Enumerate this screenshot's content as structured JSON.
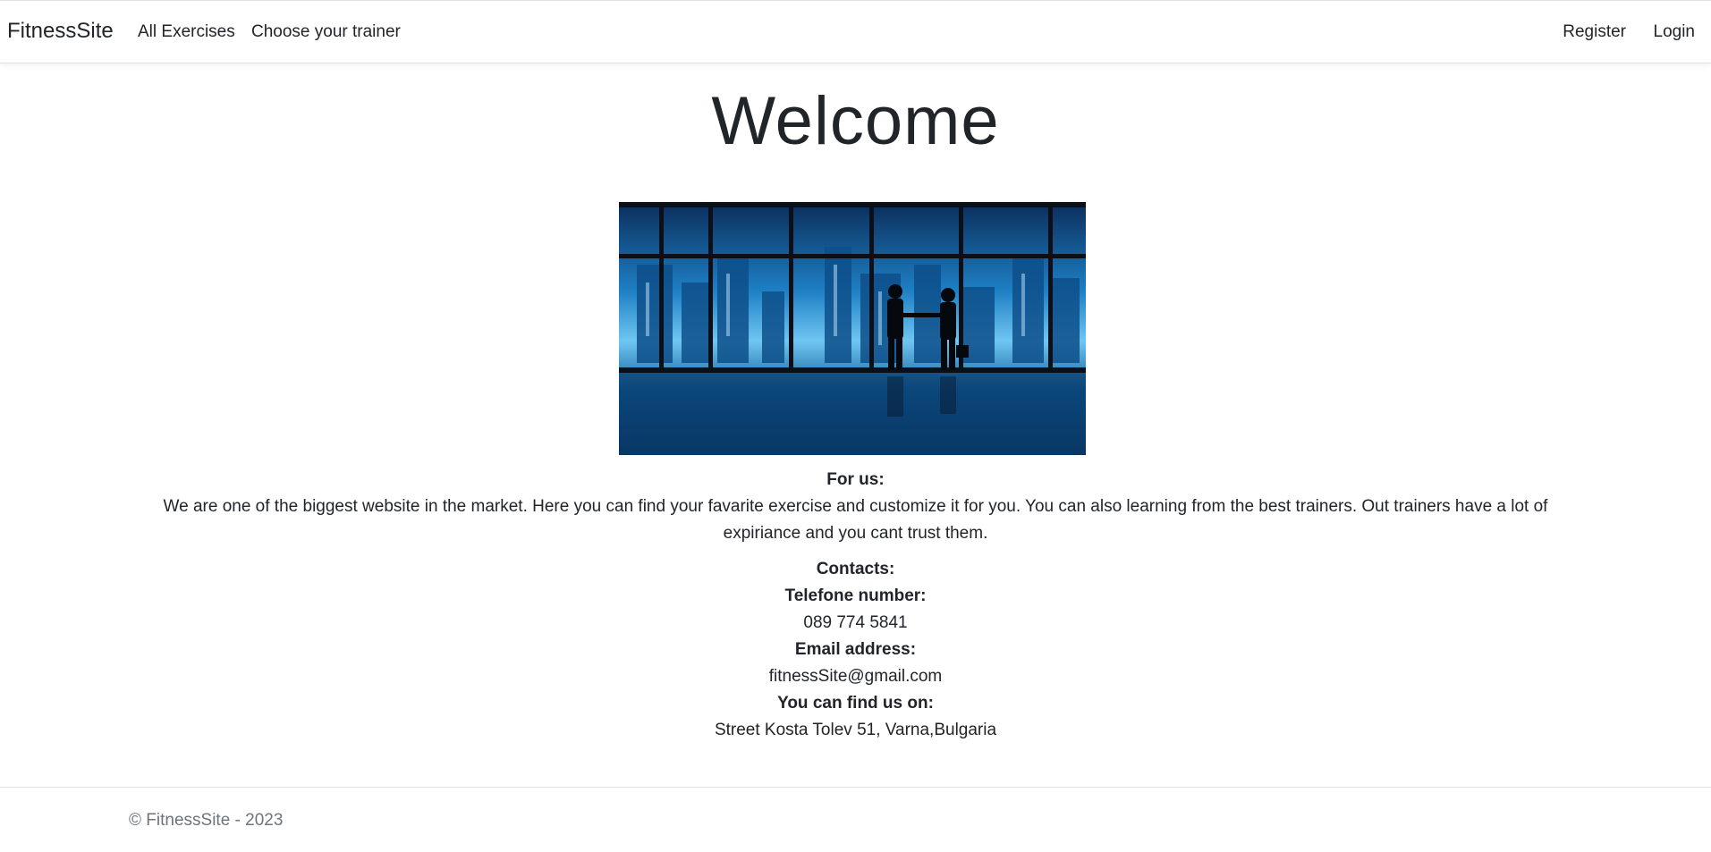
{
  "nav": {
    "brand": "FitnessSite",
    "links": [
      "All Exercises",
      "Choose your trainer"
    ],
    "register": "Register",
    "login": "Login"
  },
  "main": {
    "heading": "Welcome",
    "hero_image": "business-handshake-city-skyline-photo",
    "for_us_label": "For us:",
    "about_text": "We are one of the biggest website in the market. Here you can find your favarite exercise and customize it for you. You can also learning from the best trainers. Out trainers have a lot of expiriance and you cant trust them.",
    "contacts_label": "Contacts:",
    "phone_label": "Telefone number:",
    "phone_value": "089 774 5841",
    "email_label": "Email address:",
    "email_value": "fitnessSite@gmail.com",
    "address_label": "You can find us on:",
    "address_value": "Street Kosta Tolev 51, Varna,Bulgaria"
  },
  "footer": {
    "copyright": "© FitnessSite - 2023"
  }
}
